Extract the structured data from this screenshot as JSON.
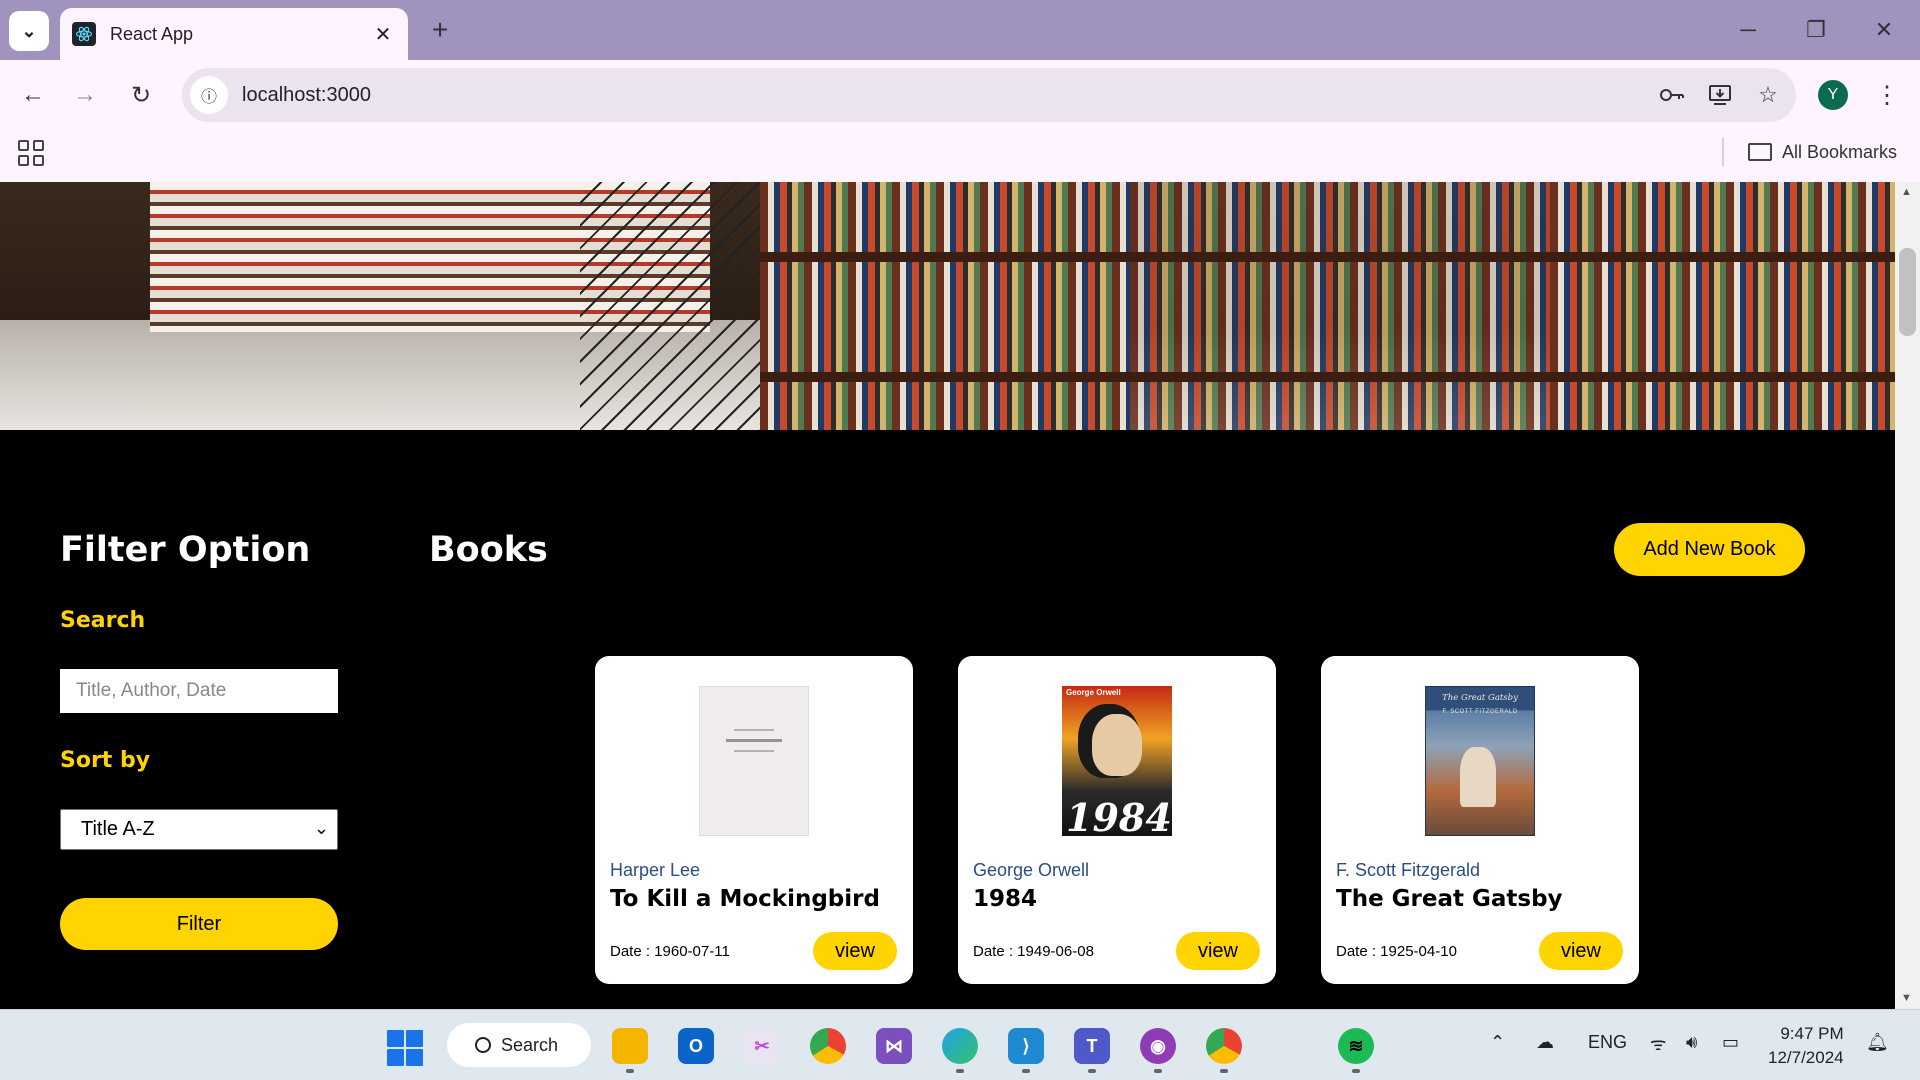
{
  "browser": {
    "tab_title": "React App",
    "url": "localhost:3000",
    "profile_initial": "Y",
    "bookmarks_label": "All Bookmarks"
  },
  "page": {
    "filter_heading": "Filter Option",
    "search_label": "Search",
    "search_placeholder": "Title, Author, Date",
    "search_value": "",
    "sort_label": "Sort by",
    "sort_selected": "Title A-Z",
    "filter_button": "Filter",
    "books_heading": "Books",
    "add_button": "Add New Book",
    "books": [
      {
        "author": "Harper Lee",
        "title": "To Kill a Mockingbird",
        "date": "Date : 1960-07-11",
        "view_label": "view"
      },
      {
        "author": "George Orwell",
        "title": "1984",
        "date": "Date : 1949-06-08",
        "view_label": "view",
        "cover_top": "George Orwell",
        "cover_big": "1984"
      },
      {
        "author": "F. Scott Fitzgerald",
        "title": "The Great Gatsby",
        "date": "Date : 1925-04-10",
        "view_label": "view",
        "cover_title": "The Great Gatsby",
        "cover_author": "F. SCOTT FITZGERALD"
      }
    ]
  },
  "taskbar": {
    "search_label": "Search",
    "language": "ENG",
    "time": "9:47 PM",
    "date": "12/7/2024"
  },
  "colors": {
    "accent_yellow": "#ffd400",
    "page_background": "#000000",
    "author_link": "#2a4e86"
  }
}
